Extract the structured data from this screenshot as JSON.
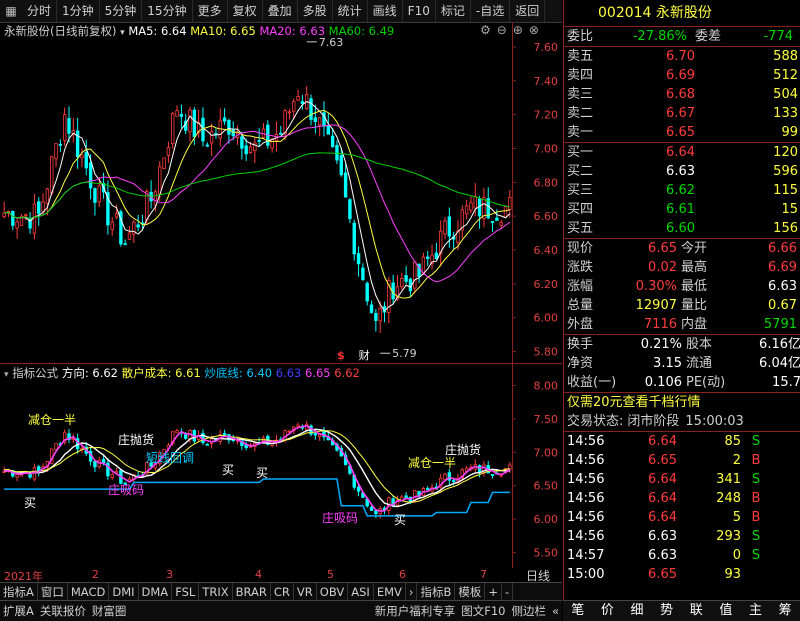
{
  "toolbar": {
    "items": [
      "分时",
      "1分钟",
      "5分钟",
      "15分钟",
      "更多",
      "复权",
      "叠加",
      "多股",
      "统计",
      "画线",
      "F10",
      "标记",
      "-自选",
      "返回"
    ]
  },
  "main_legend": {
    "title": "永新股份(日线前复权)",
    "ma5": "MA5: 6.64",
    "ma10": "MA10: 6.65",
    "ma20": "MA20: 6.63",
    "ma60": "MA60: 6.49"
  },
  "main_axis": {
    "ticks": [
      "7.60",
      "7.40",
      "7.20",
      "7.00",
      "6.80",
      "6.60",
      "6.40",
      "6.20",
      "6.00",
      "5.80"
    ],
    "ymin": 5.75,
    "ymax": 7.7
  },
  "main_annotations": {
    "high": "7.63",
    "low": "5.79",
    "s_mark": "$",
    "cai": "财"
  },
  "ind_legend": {
    "name": "指标公式",
    "dir": "方向: 6.62",
    "cost": "散户成本: 6.61",
    "bottom": "炒底线: 6.40",
    "v1": "6.63",
    "v2": "6.65",
    "v3": "6.62"
  },
  "ind_axis": {
    "ticks": [
      "8.00",
      "7.50",
      "7.00",
      "6.50",
      "6.00",
      "5.50"
    ],
    "ymin": 5.3,
    "ymax": 8.2
  },
  "ind_labels": [
    "减仓一半",
    "庄抛货",
    "短线回调",
    "买",
    "买",
    "庄吸码",
    "买",
    "庄吸码",
    "买",
    "减仓一半",
    "庄抛货"
  ],
  "dates": [
    "2021年",
    "2",
    "3",
    "4",
    "5",
    "6",
    "7"
  ],
  "period_label": "日线",
  "tabs": [
    "指标A",
    "窗口",
    "MACD",
    "DMI",
    "DMA",
    "FSL",
    "TRIX",
    "BRAR",
    "CR",
    "VR",
    "OBV",
    "ASI",
    "EMV",
    "指标B",
    "模板"
  ],
  "bottom_left": [
    "扩展A",
    "关联报价",
    "财富圈"
  ],
  "bottom_right": [
    "新用户福利专享",
    "图文F10",
    "侧边栏"
  ],
  "quote": {
    "code": "002014",
    "name": "永新股份",
    "weibi_label": "委比",
    "weibi": "-27.86%",
    "weicha_label": "委差",
    "weicha": "-774",
    "asks": [
      {
        "label": "卖五",
        "price": "6.70",
        "vol": "588"
      },
      {
        "label": "卖四",
        "price": "6.69",
        "vol": "512"
      },
      {
        "label": "卖三",
        "price": "6.68",
        "vol": "504"
      },
      {
        "label": "卖二",
        "price": "6.67",
        "vol": "133"
      },
      {
        "label": "卖一",
        "price": "6.65",
        "vol": "99"
      }
    ],
    "bids": [
      {
        "label": "买一",
        "price": "6.64",
        "vol": "120"
      },
      {
        "label": "买二",
        "price": "6.63",
        "vol": "596"
      },
      {
        "label": "买三",
        "price": "6.62",
        "vol": "115"
      },
      {
        "label": "买四",
        "price": "6.61",
        "vol": "15"
      },
      {
        "label": "买五",
        "price": "6.60",
        "vol": "156"
      }
    ],
    "stats": [
      {
        "l1": "现价",
        "v1": "6.65",
        "l2": "今开",
        "v2": "6.66"
      },
      {
        "l1": "涨跌",
        "v1": "0.02",
        "l2": "最高",
        "v2": "6.69"
      },
      {
        "l1": "涨幅",
        "v1": "0.30%",
        "l2": "最低",
        "v2": "6.63"
      },
      {
        "l1": "总量",
        "v1": "12907",
        "l2": "量比",
        "v2": "0.67"
      },
      {
        "l1": "外盘",
        "v1": "7116",
        "l2": "内盘",
        "v2": "5791"
      }
    ],
    "stats2": [
      {
        "l1": "换手",
        "v1": "0.21%",
        "l2": "股本",
        "v2": "6.16亿"
      },
      {
        "l1": "净资",
        "v1": "3.15",
        "l2": "流通",
        "v2": "6.04亿"
      },
      {
        "l1": "收益(一)",
        "v1": "0.106",
        "l2": "PE(动)",
        "v2": "15.7"
      }
    ],
    "promo": "仅需20元查看千档行情",
    "status_label": "交易状态:",
    "status": "闭市阶段",
    "status_time": "15:00:03",
    "trades": [
      {
        "t": "14:56",
        "p": "6.64",
        "v": "85",
        "d": "S"
      },
      {
        "t": "14:56",
        "p": "6.65",
        "v": "2",
        "d": "B"
      },
      {
        "t": "14:56",
        "p": "6.64",
        "v": "341",
        "d": "S"
      },
      {
        "t": "14:56",
        "p": "6.64",
        "v": "248",
        "d": "B"
      },
      {
        "t": "14:56",
        "p": "6.64",
        "v": "5",
        "d": "B"
      },
      {
        "t": "14:56",
        "p": "6.63",
        "v": "293",
        "d": "S"
      },
      {
        "t": "14:57",
        "p": "6.63",
        "v": "0",
        "d": "S"
      },
      {
        "t": "15:00",
        "p": "6.65",
        "v": "93",
        "d": ""
      }
    ],
    "bottom_tabs": [
      "笔",
      "价",
      "细",
      "势",
      "联",
      "值",
      "主",
      "筹"
    ]
  },
  "colors": {
    "up": "#ff3c3c",
    "down": "#00ffff",
    "ma5": "#ffffff",
    "ma10": "#ffff40",
    "ma20": "#ff40ff",
    "ma60": "#00d000",
    "axis": "#8b2020"
  }
}
